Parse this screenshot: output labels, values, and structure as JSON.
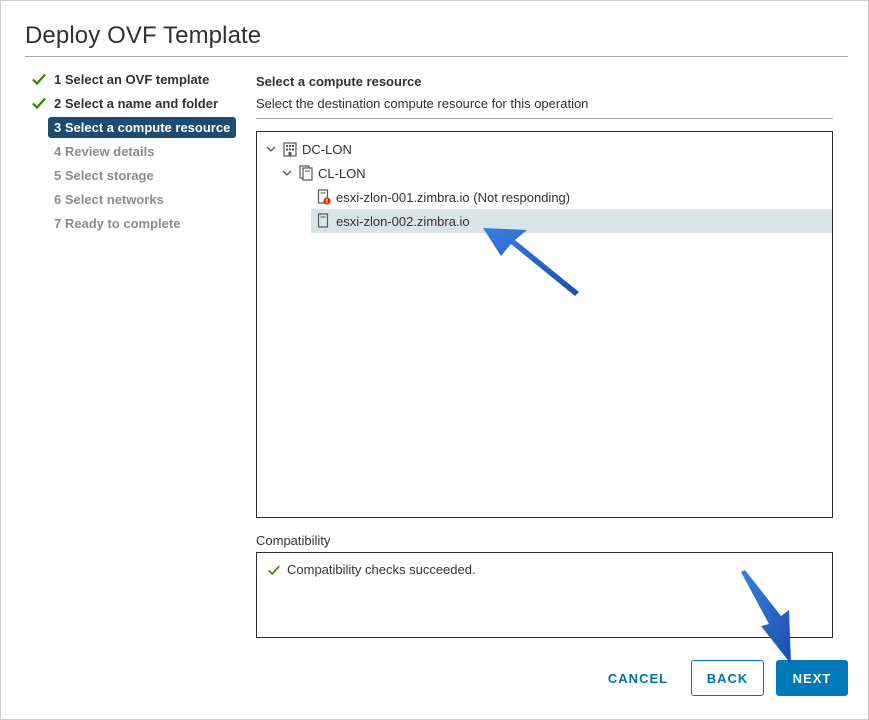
{
  "dialog": {
    "title": "Deploy OVF Template"
  },
  "steps": [
    {
      "label": "1 Select an OVF template",
      "state": "done"
    },
    {
      "label": "2 Select a name and folder",
      "state": "done"
    },
    {
      "label": "3 Select a compute resource",
      "state": "current"
    },
    {
      "label": "4 Review details",
      "state": "todo"
    },
    {
      "label": "5 Select storage",
      "state": "todo"
    },
    {
      "label": "6 Select networks",
      "state": "todo"
    },
    {
      "label": "7 Ready to complete",
      "state": "todo"
    }
  ],
  "main": {
    "heading": "Select a compute resource",
    "subheading": "Select the destination compute resource for this operation"
  },
  "tree": {
    "datacenter": {
      "label": "DC-LON",
      "icon": "datacenter-icon"
    },
    "cluster": {
      "label": "CL-LON",
      "icon": "cluster-icon"
    },
    "hosts": [
      {
        "label": "esxi-zlon-001.zimbra.io (Not responding)",
        "icon": "host-error-icon",
        "selected": false
      },
      {
        "label": "esxi-zlon-002.zimbra.io",
        "icon": "host-icon",
        "selected": true
      }
    ]
  },
  "compatibility": {
    "label": "Compatibility",
    "message": "Compatibility checks succeeded."
  },
  "buttons": {
    "cancel": "CANCEL",
    "back": "BACK",
    "next": "NEXT"
  },
  "colors": {
    "accent": "#0079b8",
    "current_step": "#1e4b73",
    "success": "#318700",
    "error": "#e62700",
    "selection": "#d9e4ea",
    "annotation_arrow": "#1f5fc6"
  }
}
